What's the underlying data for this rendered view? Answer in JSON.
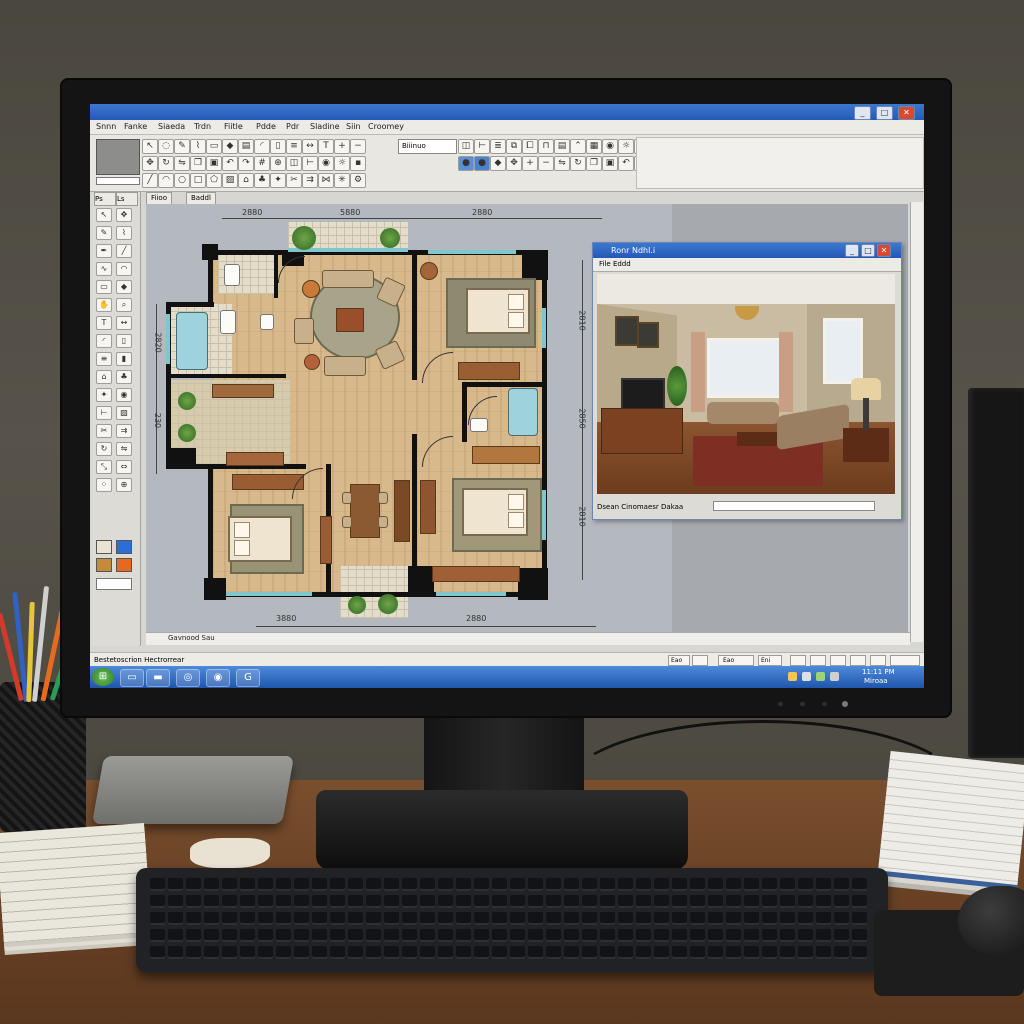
{
  "app": {
    "title": "",
    "window_buttons": [
      "_",
      "□",
      "✕"
    ]
  },
  "menu": {
    "items": [
      "Snnn",
      "Fanke",
      "Siaeda",
      "Trdn",
      "Fiitle",
      "Pdde",
      "Pdr",
      "Sladine",
      "Siin",
      "Croomey"
    ]
  },
  "toolbar": {
    "field_text": "Biiinuo",
    "icons": [
      "cursor-icon",
      "lasso-icon",
      "pencil-icon",
      "brush-icon",
      "eraser-icon",
      "fill-icon",
      "wall-icon",
      "door-icon",
      "window-icon",
      "stair-icon",
      "dimension-icon",
      "text-icon",
      "zoom-in-icon",
      "zoom-out-icon",
      "pan-icon",
      "rotate-icon",
      "mirror-icon",
      "copy-icon",
      "paste-icon",
      "undo-icon",
      "redo-icon",
      "grid-icon",
      "snap-icon",
      "layer-icon",
      "measure-icon",
      "camera-icon",
      "render-icon",
      "save-icon"
    ]
  },
  "palette": {
    "tabs": [
      "Ps",
      "Ls"
    ],
    "colors": [
      "#e9e3d3",
      "#2b6fd6",
      "#c58a3a",
      "#e36a1e",
      "#f0f0f0"
    ]
  },
  "document": {
    "tabs": [
      "Fiioo",
      "Baddl"
    ],
    "footer_label": "Gavnood Sau",
    "dimensions": {
      "top_left": "2880",
      "top_mid": "5880",
      "top_right": "2880",
      "bottom_left": "3880",
      "bottom_right": "2880",
      "right_1": "2810",
      "right_2": "2850",
      "right_3": "2810",
      "left_1": "2820",
      "left_2": "230"
    }
  },
  "preview": {
    "title": "Ronr Ndhl.i",
    "menu_label": "File Eddd",
    "footer_label": "Dsean Cinomaesr Dakaa"
  },
  "status": {
    "left_text": "Bestetoscrion  Hectrorrear",
    "cells": [
      "Eao",
      "Eao",
      "Eni"
    ]
  },
  "taskbar": {
    "start_icon": "windows-start-icon",
    "clock": "11:11 PM",
    "date": "Miroaa"
  }
}
